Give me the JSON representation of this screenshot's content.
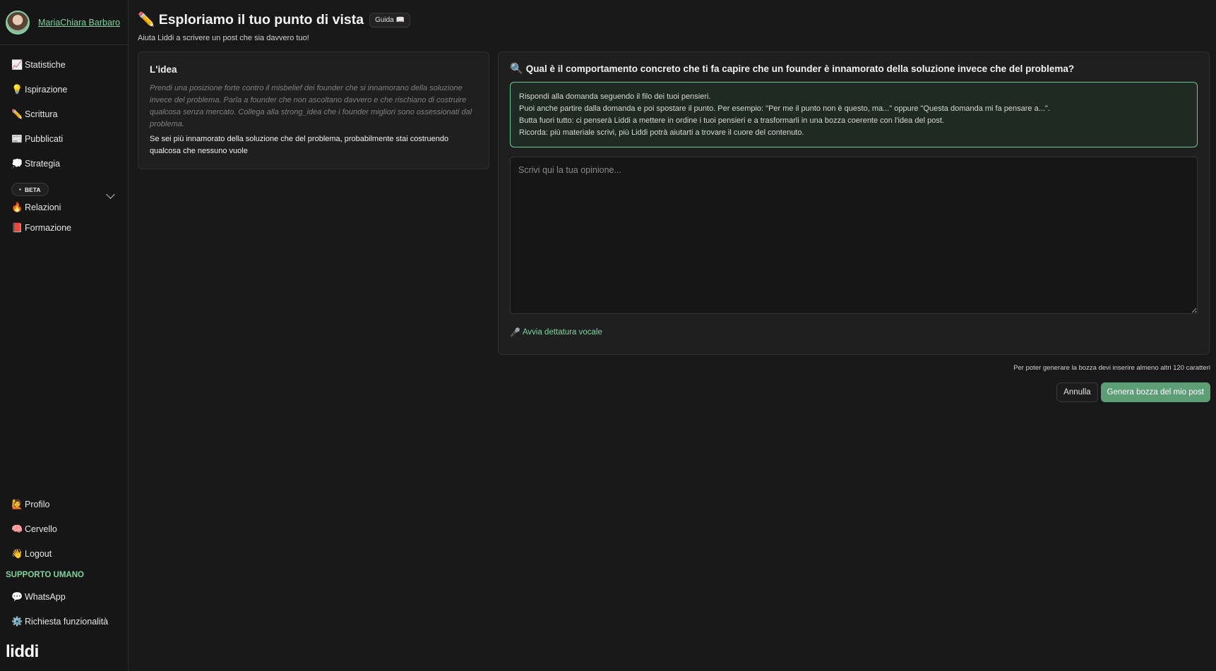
{
  "user": {
    "name": "MariaChiara Barbaro"
  },
  "sidebar": {
    "items": [
      {
        "icon": "📈",
        "label": "Statistiche"
      },
      {
        "icon": "💡",
        "label": "Ispirazione"
      },
      {
        "icon": "✏️",
        "label": "Scrittura"
      },
      {
        "icon": "📰",
        "label": "Pubblicati"
      },
      {
        "icon": "💭",
        "label": "Strategia"
      }
    ],
    "beta": {
      "badge": "BETA",
      "icon": "🔥",
      "label": "Relazioni"
    },
    "formazione": {
      "icon": "📕",
      "label": "Formazione"
    },
    "bottom_items": [
      {
        "icon": "🙋",
        "label": "Profilo"
      },
      {
        "icon": "🧠",
        "label": "Cervello"
      },
      {
        "icon": "👋",
        "label": "Logout"
      }
    ],
    "support_title": "SUPPORTO UMANO",
    "support_items": [
      {
        "icon": "💬",
        "label": "WhatsApp"
      },
      {
        "icon": "⚙️",
        "label": "Richiesta funzionalità"
      }
    ],
    "logo": "liddi"
  },
  "header": {
    "icon": "✏️",
    "title": "Esploriamo il tuo punto di vista",
    "guide_label": "Guida 📖",
    "subtitle": "Aiuta Liddi a scrivere un post che sia davvero tuo!"
  },
  "idea": {
    "title": "L'idea",
    "description": "Prendi una posizione forte contro il misbelief dei founder che si innamorano della soluzione invece del problema. Parla a founder che non ascoltano davvero e che rischiano di costruire qualcosa senza mercato. Collega alla strong_idea che i founder migliori sono ossessionati dal problema.",
    "strong_idea": "Se sei più innamorato della soluzione che del problema, probabilmente stai costruendo qualcosa che nessuno vuole"
  },
  "question": {
    "icon": "🔍",
    "title": "Qual è il comportamento concreto che ti fa capire che un founder è innamorato della soluzione invece che del problema?",
    "hints": [
      "Rispondi alla domanda seguendo il filo dei tuoi pensieri.",
      "Puoi anche partire dalla domanda e poi spostare il punto. Per esempio: \"Per me il punto non è questo, ma...\" oppure \"Questa domanda mi fa pensare a...\".",
      "Butta fuori tutto: ci penserà Liddi a mettere in ordine i tuoi pensieri e a trasformarli in una bozza coerente con l'idea del post.",
      "Ricorda: più materiale scrivi, più Liddi potrà aiutarti a trovare il cuore del contenuto."
    ],
    "input_placeholder": "Scrivi qui la tua opinione...",
    "input_value": "",
    "dictation_icon": "🎤",
    "dictation_label": "Avvia dettatura vocale"
  },
  "footer": {
    "char_note": "Per poter generare la bozza devi inserire almeno altri 120 caratteri",
    "cancel_label": "Annulla",
    "generate_label": "Genera bozza del mio post"
  },
  "colors": {
    "accent": "#7ed3a0",
    "button_green": "#5c9f77",
    "background": "#181818"
  }
}
